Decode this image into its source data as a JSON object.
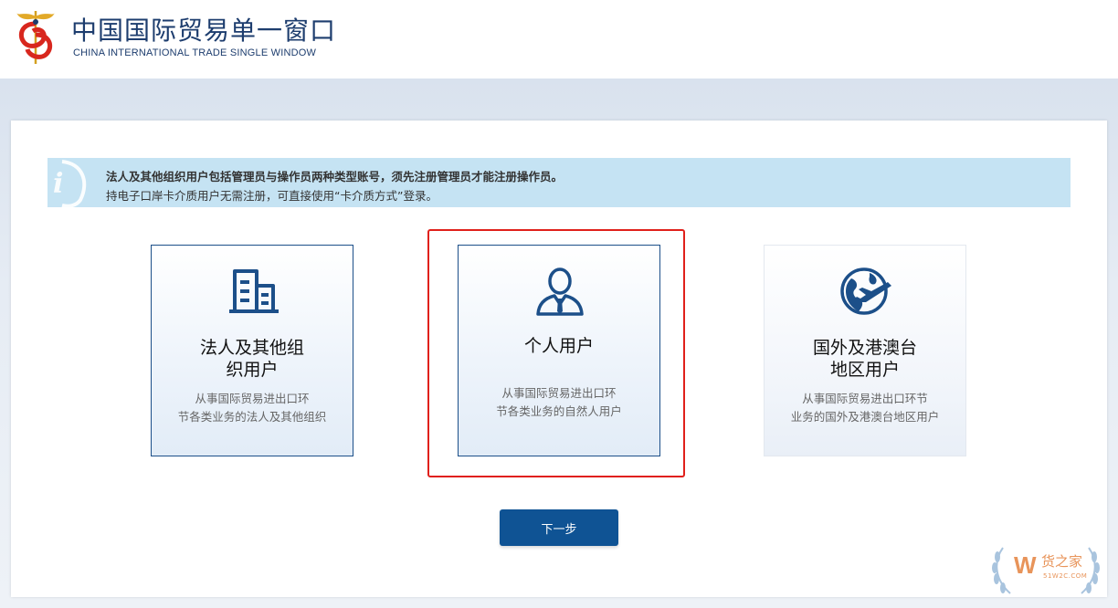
{
  "header": {
    "title": "中国国际贸易单一窗口",
    "subtitle": "CHINA INTERNATIONAL TRADE SINGLE WINDOW",
    "logo_icon": "caduceus-logo-icon"
  },
  "notice": {
    "icon": "info-icon",
    "line1": "法人及其他组织用户包括管理员与操作员两种类型账号，须先注册管理员才能注册操作员。",
    "line2": "持电子口岸卡介质用户无需注册，可直接使用“卡介质方式”登录。"
  },
  "options": [
    {
      "icon": "building-icon",
      "title": "法人及其他组织用户",
      "desc": "从事国际贸易进出口环节各类业务的法人及其他组织",
      "selected": false
    },
    {
      "icon": "person-icon",
      "title": "个人用户",
      "desc": "从事国际贸易进出口环节各类业务的自然人用户",
      "selected": true
    },
    {
      "icon": "globe-plane-icon",
      "title": "国外及港澳台地区用户",
      "desc": "从事国际贸易进出口环节业务的国外及港澳台地区用户",
      "selected": false
    }
  ],
  "next_label": "下一步",
  "watermark": {
    "text": "货之家",
    "sub": "51W2C.COM",
    "letter": "W"
  },
  "colors": {
    "brand": "#0f5394",
    "border": "#1c4f89",
    "selection": "#e0201b",
    "notice_bg": "#c5e3f3"
  }
}
